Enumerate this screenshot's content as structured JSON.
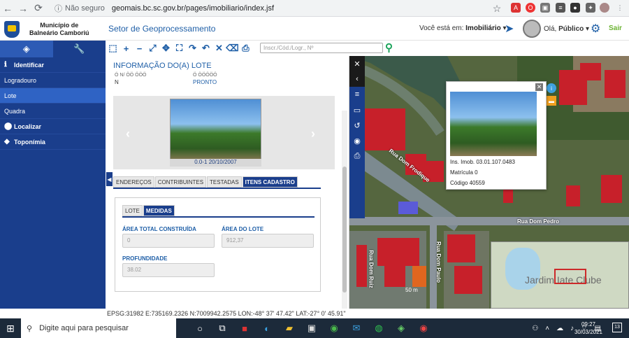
{
  "browser": {
    "insecure_label": "Não seguro",
    "url": "geomais.bc.sc.gov.br/pages/imobiliario/index.jsf"
  },
  "header": {
    "municipality_line1": "Município de",
    "municipality_line2": "Balneário Camboriú",
    "sector": "Setor de Geoprocessamento",
    "where_label": "Você está em:",
    "where_value": "Imobiliário",
    "user_greeting": "Olá,",
    "user_name": "Público",
    "logout": "Sair"
  },
  "sidebar": {
    "identificar": "Identificar",
    "items": [
      "Logradouro",
      "Lote",
      "Quadra"
    ],
    "localizar": "Localizar",
    "toponimia": "Toponímia"
  },
  "toolbar": {
    "search_placeholder": "Inscr./Cód./Logr., Nº"
  },
  "panel": {
    "title": "INFORMAÇÃO DO(A) LOTE",
    "field_a_label": "Ó N/ ÖÖ ÖÖÖ",
    "field_a_value": "N",
    "field_b_label": "Ö ÖÖÖÖÖ",
    "field_b_value": "PRONTO",
    "photo_caption": "0.0-1 20/10/2007",
    "tabs": [
      "ENDEREÇOS",
      "CONTRIBUINTES",
      "TESTADAS",
      "ITENS CADASTRO"
    ],
    "subtabs": [
      "LOTE",
      "MEDIDAS"
    ],
    "fields": {
      "area_total_label": "ÁREA TOTAL CONSTRUÍDA",
      "area_total_value": "0",
      "area_lote_label": "ÁREA DO LOTE",
      "area_lote_value": "912,37",
      "profundidade_label": "PROFUNDIDADE",
      "profundidade_value": "38.02"
    }
  },
  "map": {
    "popup": {
      "inscricao": "Ins. Imob. 03.01.107.0483",
      "matricula": "Matrícula 0",
      "codigo": "Código 40559"
    },
    "roads": [
      "Rua Dom Frodique",
      "Rua Dom Pedro",
      "Rua Dom Paulo",
      "Rua Dom Ruiz"
    ],
    "minimap_label": "Jardim Iate Clube",
    "scale": "50 m"
  },
  "status": "EPSG:31982 E:735169.2326 N:7009942.2575 LON:-48° 37' 47.42\" LAT:-27° 0' 45.91\"",
  "taskbar": {
    "search": "Digite aqui para pesquisar",
    "time": "09:27",
    "date": "30/03/2021",
    "notifications": "13"
  }
}
